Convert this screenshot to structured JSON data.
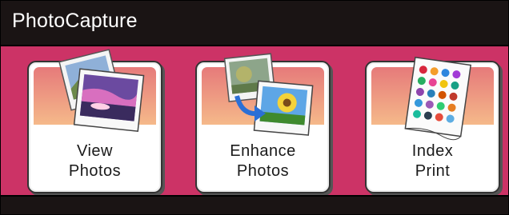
{
  "header": {
    "title": "PhotoCapture"
  },
  "tiles": [
    {
      "line1": "View",
      "line2": "Photos",
      "icon": "photos-stack-icon"
    },
    {
      "line1": "Enhance",
      "line2": "Photos",
      "icon": "enhance-photo-icon"
    },
    {
      "line1": "Index",
      "line2": "Print",
      "icon": "index-sheet-icon"
    }
  ],
  "colors": {
    "background": "#cc3366",
    "title_bar": "#1a1414",
    "tile": "#ffffff"
  }
}
